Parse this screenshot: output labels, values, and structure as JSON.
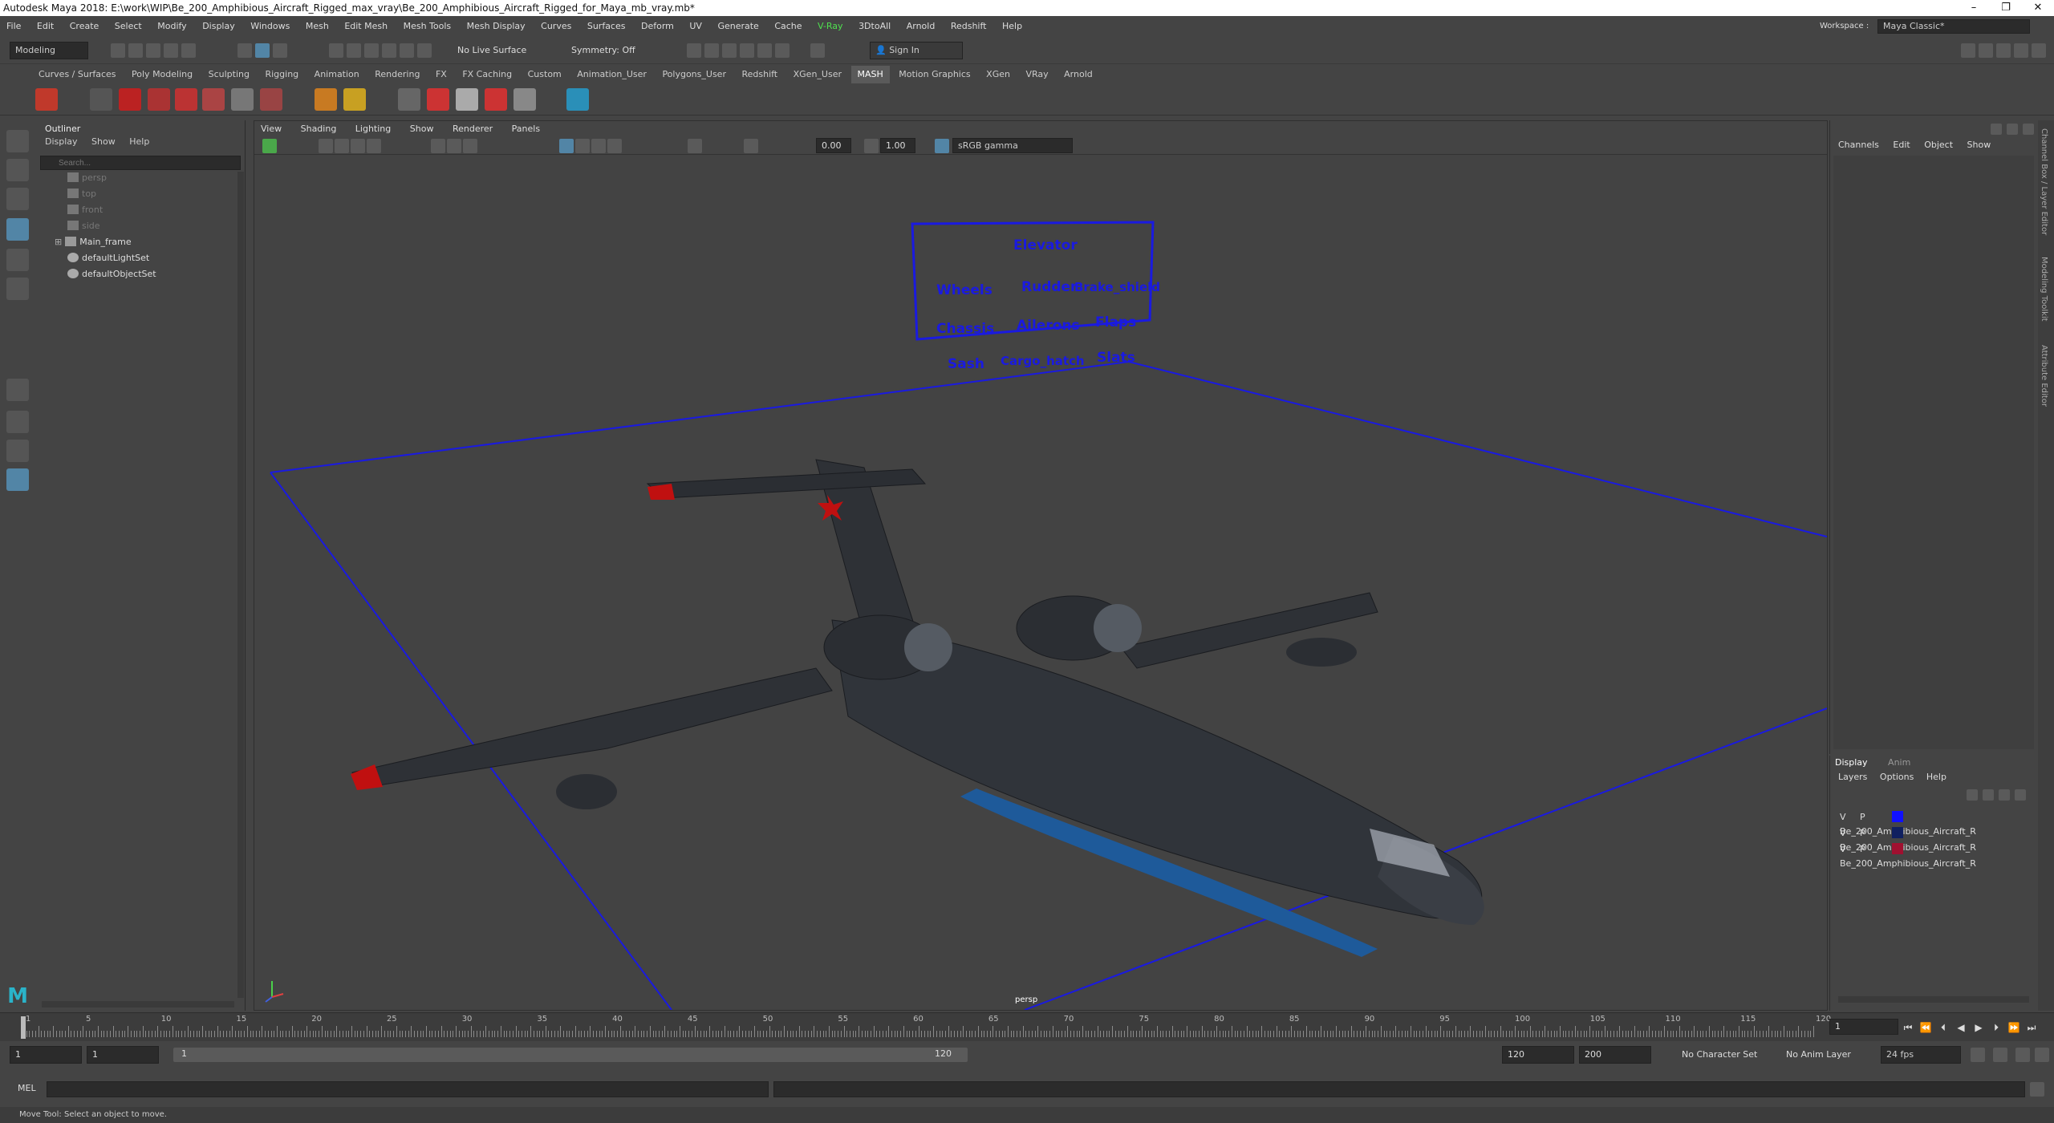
{
  "window": {
    "title": "Autodesk Maya 2018: E:\\work\\WIP\\Be_200_Amphibious_Aircraft_Rigged_max_vray\\Be_200_Amphibious_Aircraft_Rigged_for_Maya_mb_vray.mb*",
    "minimize": "–",
    "restore": "❐",
    "close": "✕"
  },
  "menubar": [
    "File",
    "Edit",
    "Create",
    "Select",
    "Modify",
    "Display",
    "Windows",
    "Mesh",
    "Edit Mesh",
    "Mesh Tools",
    "Mesh Display",
    "Curves",
    "Surfaces",
    "Deform",
    "UV",
    "Generate",
    "Cache",
    "V-Ray",
    "3DtoAll",
    "Arnold",
    "Redshift",
    "Help"
  ],
  "workspace": {
    "label": "Workspace :",
    "value": "Maya Classic*"
  },
  "statusline": {
    "mode": "Modeling",
    "live_surface": "No Live Surface",
    "symmetry": "Symmetry: Off",
    "sign_in": "Sign In"
  },
  "shelf_tabs": [
    "Curves / Surfaces",
    "Poly Modeling",
    "Sculpting",
    "Rigging",
    "Animation",
    "Rendering",
    "FX",
    "FX Caching",
    "Custom",
    "Animation_User",
    "Polygons_User",
    "Redshift",
    "XGen_User",
    "MASH",
    "Motion Graphics",
    "XGen",
    "VRay",
    "Arnold"
  ],
  "active_shelf": "MASH",
  "outliner": {
    "title": "Outliner",
    "menu": [
      "Display",
      "Show",
      "Help"
    ],
    "search_placeholder": "Search...",
    "items": [
      {
        "label": "persp",
        "dim": true
      },
      {
        "label": "top",
        "dim": true
      },
      {
        "label": "front",
        "dim": true
      },
      {
        "label": "side",
        "dim": true
      },
      {
        "label": "Main_frame",
        "dim": false
      },
      {
        "label": "defaultLightSet",
        "dim": false
      },
      {
        "label": "defaultObjectSet",
        "dim": false
      }
    ]
  },
  "viewport": {
    "menu": [
      "View",
      "Shading",
      "Lighting",
      "Show",
      "Renderer",
      "Panels"
    ],
    "exposure": "0.00",
    "gamma": "1.00",
    "color_space": "sRGB gamma",
    "camera": "persp",
    "controls": [
      "Elevator",
      "Wheels",
      "Rudder",
      "Brake_shield",
      "Chassis",
      "Ailerons",
      "Flaps",
      "Sash",
      "Cargo_hatch",
      "Slats"
    ]
  },
  "channelbox": {
    "menu": [
      "Channels",
      "Edit",
      "Object",
      "Show"
    ]
  },
  "side_tabs": [
    "Channel Box / Layer Editor",
    "Modeling Toolkit",
    "Attribute Editor"
  ],
  "layer_editor": {
    "tabs": [
      "Display",
      "Anim"
    ],
    "menu": [
      "Layers",
      "Options",
      "Help"
    ],
    "layers": [
      {
        "v": "V",
        "p": "P",
        "color": "#1010ff",
        "name": "Be_200_Amphibious_Aircraft_R"
      },
      {
        "v": "V",
        "p": "P",
        "color": "#102060",
        "name": "Be_200_Amphibious_Aircraft_R"
      },
      {
        "v": "V",
        "p": "P",
        "color": "#a01030",
        "name": "Be_200_Amphibious_Aircraft_R"
      }
    ]
  },
  "timeline": {
    "ticks": [
      "1",
      "5",
      "10",
      "15",
      "20",
      "25",
      "30",
      "35",
      "40",
      "45",
      "50",
      "55",
      "60",
      "65",
      "70",
      "75",
      "80",
      "85",
      "90",
      "95",
      "100",
      "105",
      "110",
      "115",
      "120"
    ],
    "current_frame": "1",
    "start": "1",
    "range_start": "1",
    "range_bar_start": "1",
    "range_bar_end": "120",
    "range_end": "120",
    "end": "200",
    "character_set": "No Character Set",
    "anim_layer": "No Anim Layer",
    "fps": "24 fps"
  },
  "cmdline": {
    "label": "MEL"
  },
  "helpline": "Move Tool: Select an object to move."
}
